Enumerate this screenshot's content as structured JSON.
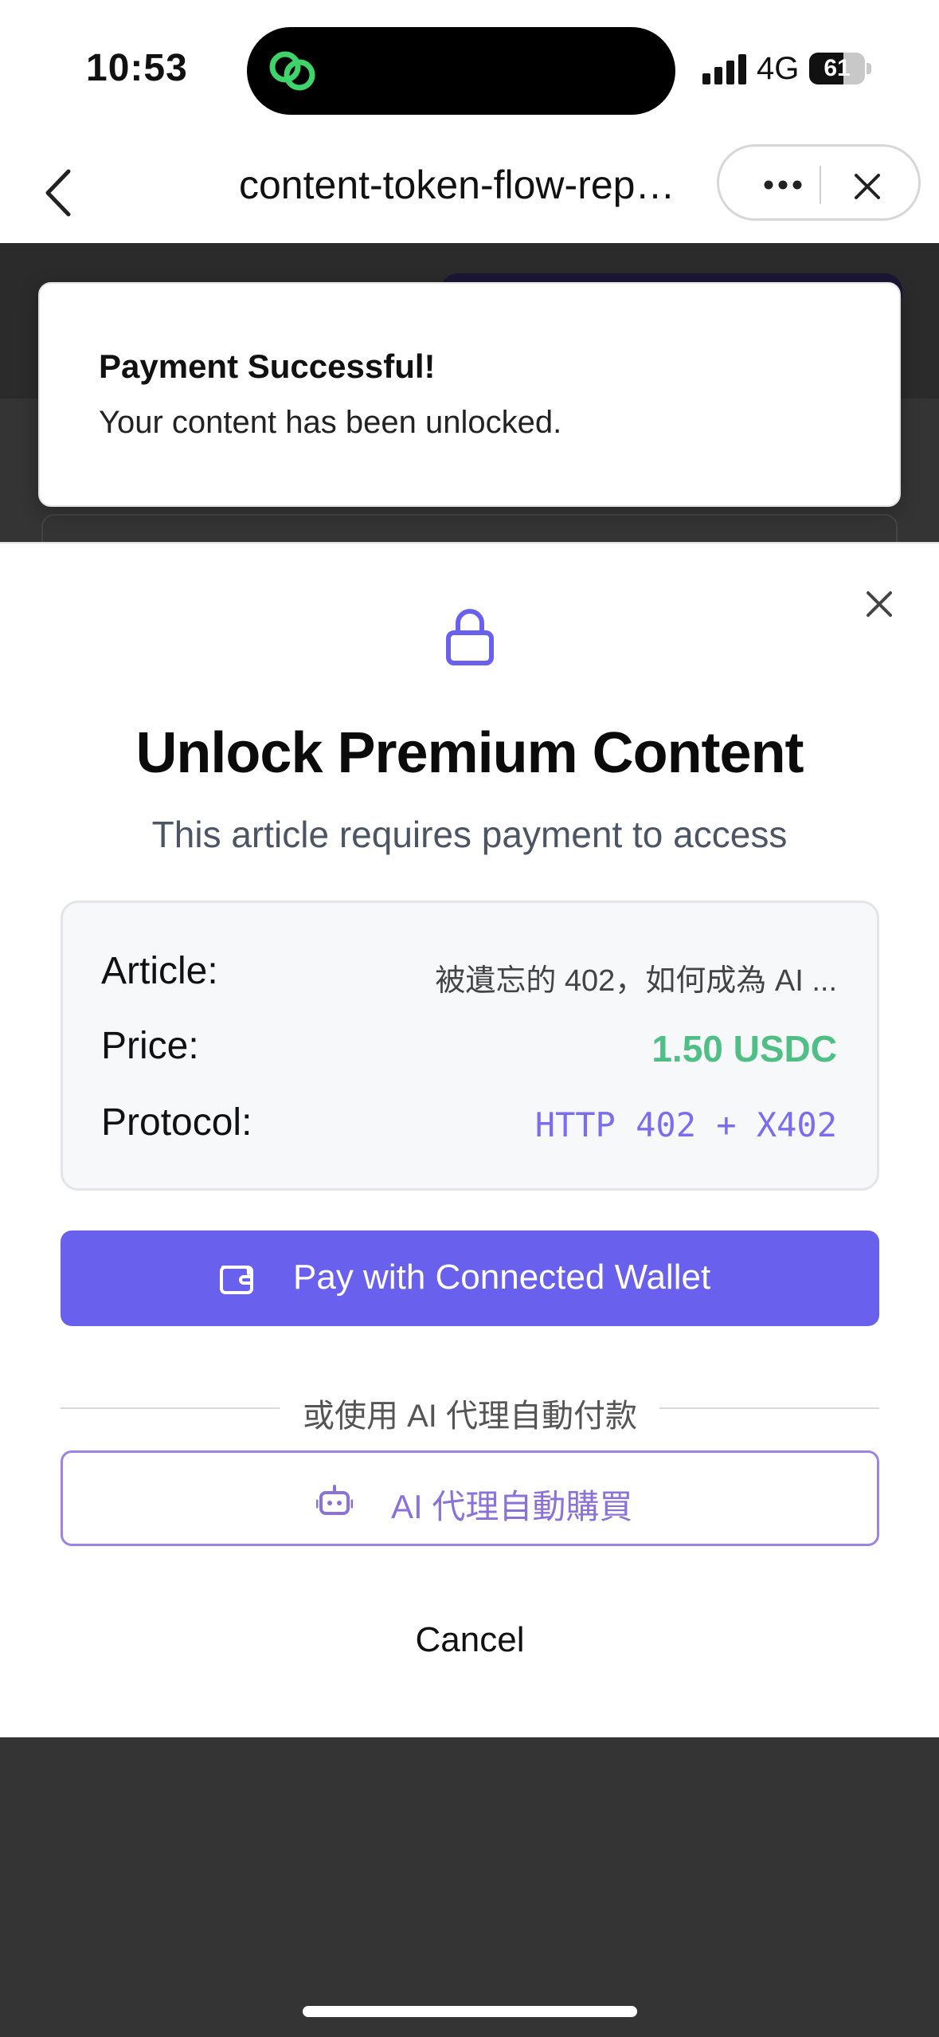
{
  "status_bar": {
    "time": "10:53",
    "network": "4G",
    "battery_percent": "61",
    "battery_level": 0.61,
    "island_app_icon": "link-rings-icon"
  },
  "nav": {
    "title": "content-token-flow-rep…",
    "back_icon": "chevron-left-icon",
    "more_icon": "ellipsis-icon",
    "close_icon": "close-icon"
  },
  "toast": {
    "title": "Payment Successful!",
    "message": "Your content has been unlocked."
  },
  "modal": {
    "close_icon": "close-icon",
    "lock_icon": "lock-icon",
    "title": "Unlock Premium Content",
    "subtitle": "This article requires payment to access",
    "details": {
      "article_label": "Article:",
      "article_value": "被遺忘的 402，如何成為 AI ...",
      "price_label": "Price:",
      "price_value": "1.50 USDC",
      "protocol_label": "Protocol:",
      "protocol_value": "HTTP 402 + X402"
    },
    "pay_button": {
      "label": "Pay with Connected Wallet",
      "icon": "wallet-icon"
    },
    "divider_text": "或使用 AI 代理自動付款",
    "ai_button": {
      "label": "AI 代理自動購買",
      "icon": "robot-icon"
    },
    "cancel_label": "Cancel"
  },
  "colors": {
    "accent": "#6a60ee",
    "price_green": "#4fbf86",
    "protocol_purple": "#7b6cf0",
    "ai_outline": "#9a84e6",
    "backdrop": "#343434"
  }
}
